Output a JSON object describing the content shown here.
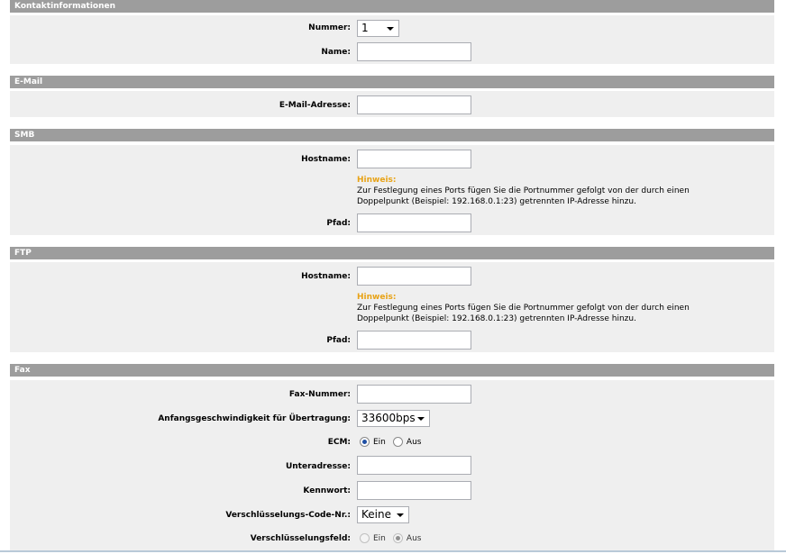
{
  "contact": {
    "header": "Kontaktinformationen",
    "number_label": "Nummer:",
    "number_value": "1",
    "name_label": "Name:",
    "name_value": ""
  },
  "email": {
    "header": "E-Mail",
    "address_label": "E-Mail-Adresse:",
    "address_value": ""
  },
  "smb": {
    "header": "SMB",
    "hostname_label": "Hostname:",
    "hostname_value": "",
    "hint_title": "Hinweis:",
    "hint_line1": "Zur Festlegung eines Ports fügen Sie die Portnummer gefolgt von der durch einen",
    "hint_line2": "Doppelpunkt (Beispiel: 192.168.0.1:23) getrennten IP-Adresse hinzu.",
    "path_label": "Pfad:",
    "path_value": ""
  },
  "ftp": {
    "header": "FTP",
    "hostname_label": "Hostname:",
    "hostname_value": "",
    "hint_title": "Hinweis:",
    "hint_line1": "Zur Festlegung eines Ports fügen Sie die Portnummer gefolgt von der durch einen",
    "hint_line2": "Doppelpunkt (Beispiel: 192.168.0.1:23) getrennten IP-Adresse hinzu.",
    "path_label": "Pfad:",
    "path_value": ""
  },
  "fax": {
    "header": "Fax",
    "number_label": "Fax-Nummer:",
    "number_value": "",
    "speed_label": "Anfangsgeschwindigkeit für Übertragung:",
    "speed_value": "33600bps",
    "ecm_label": "ECM:",
    "ecm_on": "Ein",
    "ecm_off": "Aus",
    "subaddress_label": "Unteradresse:",
    "subaddress_value": "",
    "password_label": "Kennwort:",
    "password_value": "",
    "encryption_code_label": "Verschlüsselungs-Code-Nr.:",
    "encryption_code_value": "Keine",
    "encryption_field_label": "Verschlüsselungsfeld:",
    "encryption_field_on": "Ein",
    "encryption_field_off": "Aus"
  },
  "colors": {
    "section_header_bg": "#9d9d9d",
    "section_body_bg": "#efefef",
    "hint_title": "#e8a317",
    "radio_checked": "#1f4fa3"
  }
}
